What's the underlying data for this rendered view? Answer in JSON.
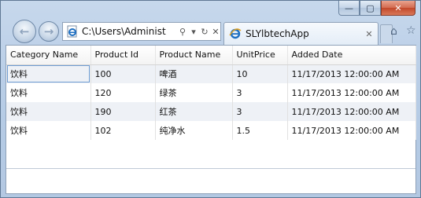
{
  "window": {
    "minimize_glyph": "—",
    "maximize_glyph": "▢",
    "close_glyph": "✕"
  },
  "nav": {
    "back_glyph": "←",
    "forward_glyph": "→"
  },
  "address_bar": {
    "url": "C:\\Users\\Administ",
    "search_glyph": "⚲",
    "dropdown_glyph": "▾",
    "refresh_glyph": "↻",
    "stop_glyph": "✕"
  },
  "tab": {
    "title": "SLYlbtechApp",
    "close_glyph": "✕"
  },
  "toolbar": {
    "home_glyph": "⌂",
    "favorites_glyph": "☆"
  },
  "grid": {
    "columns": [
      "Category Name",
      "Product Id",
      "Product Name",
      "UnitPrice",
      "Added Date"
    ],
    "rows": [
      [
        "饮料",
        "100",
        "啤酒",
        "10",
        "11/17/2013 12:00:00 AM"
      ],
      [
        "饮料",
        "120",
        "绿茶",
        "3",
        "11/17/2013 12:00:00 AM"
      ],
      [
        "饮料",
        "190",
        "红茶",
        "3",
        "11/17/2013 12:00:00 AM"
      ],
      [
        "饮料",
        "102",
        "纯净水",
        "1.5",
        "11/17/2013 12:00:00 AM"
      ]
    ]
  },
  "colors": {
    "accent": "#1e6fc1",
    "alt_row": "#eef1f6",
    "close_button": "#c2482a"
  }
}
